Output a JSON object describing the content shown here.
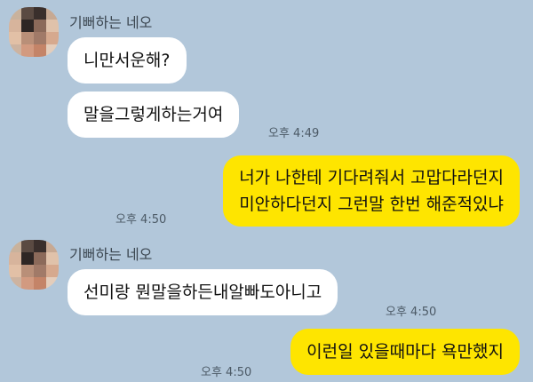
{
  "chat": {
    "groups": [
      {
        "sender": "기뻐하는 네오",
        "messages": [
          {
            "text": "니만서운해?"
          },
          {
            "text": "말을그렇게하는거여",
            "time": "오후 4:49"
          }
        ]
      },
      {
        "outgoing": true,
        "messages": [
          {
            "lines": [
              "너가 나한테 기다려줘서 고맙다라던지",
              "미안하다던지 그런말 한번 해준적있냐"
            ],
            "time": "오후 4:50"
          }
        ]
      },
      {
        "sender": "기뻐하는 네오",
        "messages": [
          {
            "text": "선미랑 뭔말을하든내알빠도아니고",
            "time": "오후 4:50"
          }
        ]
      },
      {
        "outgoing": true,
        "messages": [
          {
            "text": "이런일 있을때마다 욕만했지",
            "time": "오후 4:50"
          }
        ]
      }
    ]
  },
  "colors": {
    "background": "#b2c7da",
    "outgoing_bubble": "#fee500",
    "incoming_bubble": "#ffffff"
  },
  "avatar": {
    "icon": "pixelated-profile-avatar"
  }
}
